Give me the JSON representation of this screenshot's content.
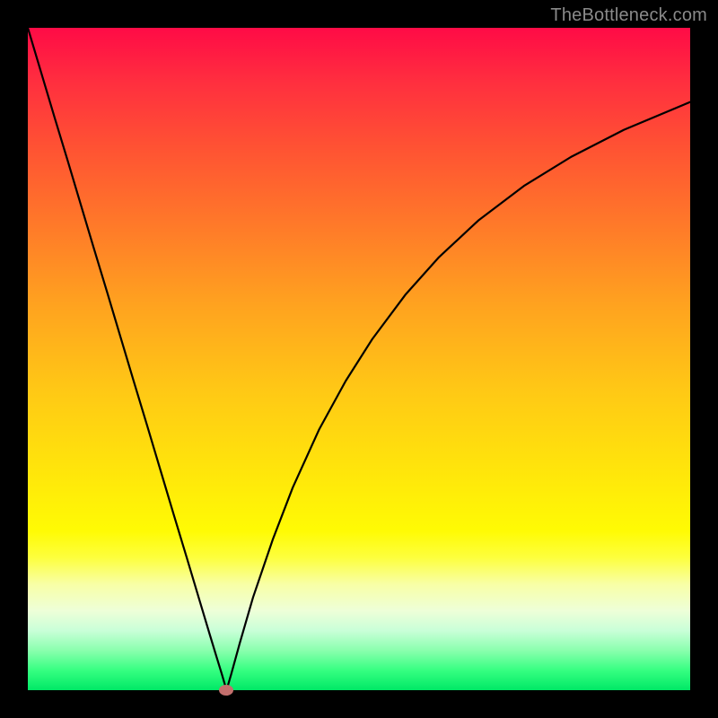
{
  "branding": {
    "watermark": "TheBottleneck.com"
  },
  "colors": {
    "frame": "#000000",
    "curve": "#000000",
    "vertex_dot": "#c36f6d",
    "gradient_top": "#ff0b46",
    "gradient_bottom": "#00e866"
  },
  "chart_data": {
    "type": "line",
    "title": "",
    "xlabel": "",
    "ylabel": "",
    "xlim": [
      0,
      100
    ],
    "ylim": [
      0,
      100
    ],
    "grid": false,
    "legend": false,
    "series": [
      {
        "name": "bottleneck-curve",
        "x": [
          0,
          2,
          4,
          6,
          8,
          10,
          12,
          14,
          16,
          18,
          20,
          22,
          24,
          26,
          27.5,
          28.5,
          29.3,
          30,
          30.7,
          32,
          34,
          37,
          40,
          44,
          48,
          52,
          57,
          62,
          68,
          75,
          82,
          90,
          100
        ],
        "y": [
          100,
          93.3,
          86.6,
          80,
          73.3,
          66.6,
          60,
          53.3,
          46.6,
          40,
          33.3,
          26.6,
          20,
          13.3,
          8.3,
          5,
          2.4,
          0,
          2.4,
          7.1,
          14,
          22.8,
          30.6,
          39.4,
          46.7,
          53,
          59.7,
          65.3,
          70.9,
          76.2,
          80.5,
          84.6,
          88.8
        ]
      }
    ],
    "annotations": [
      {
        "type": "marker",
        "name": "vertex",
        "x": 30,
        "y": 0,
        "shape": "ellipse"
      }
    ]
  }
}
